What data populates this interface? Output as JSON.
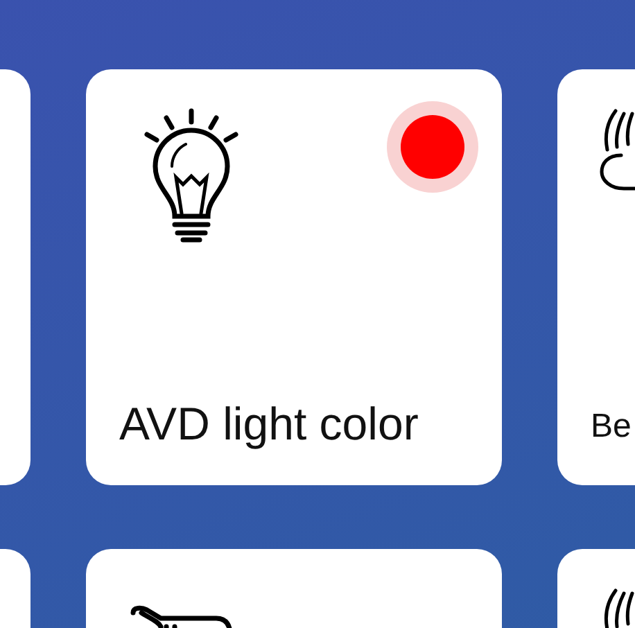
{
  "tiles": [
    {
      "kind": "empty"
    },
    {
      "kind": "bulb",
      "label": "AVD light color",
      "color": "#ff0000"
    },
    {
      "kind": "wave",
      "label": "Be"
    },
    {
      "kind": "empty"
    },
    {
      "kind": "point"
    },
    {
      "kind": "wave"
    }
  ]
}
